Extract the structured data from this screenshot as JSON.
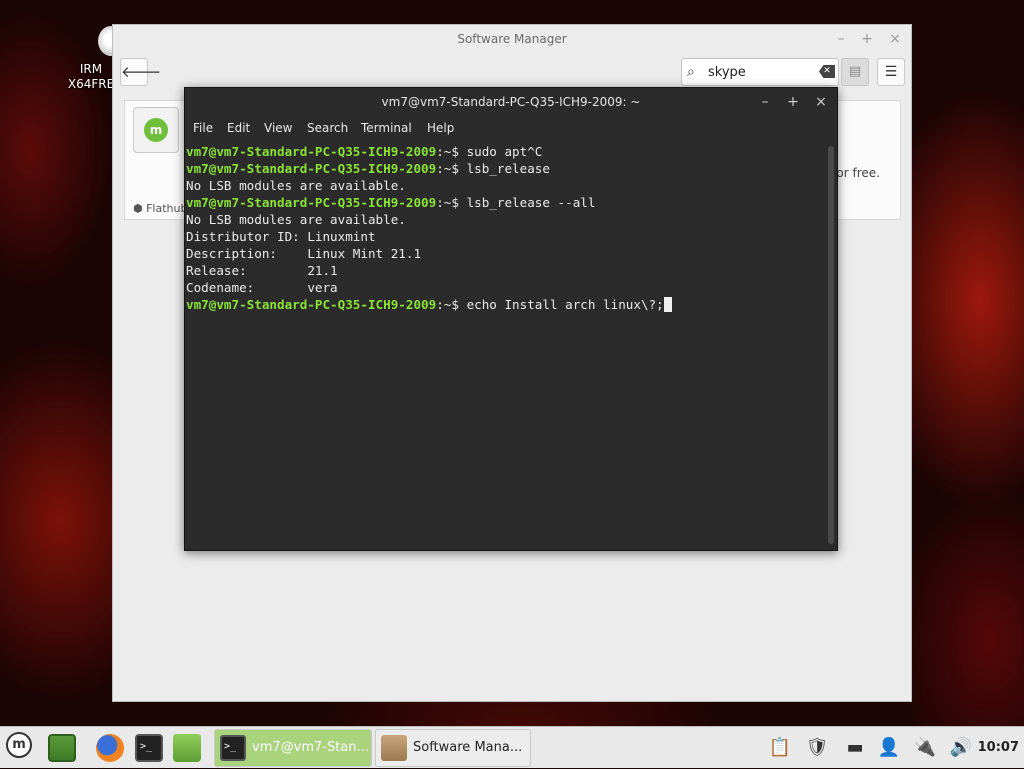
{
  "desktop": {
    "icon_label_line1": "IRM",
    "icon_label_line2": "X64FRE"
  },
  "software_manager": {
    "title": "Software Manager",
    "search_value": "skype",
    "card_source": "Flathub",
    "card_desc_fragment": "or free."
  },
  "terminal": {
    "title": "vm7@vm7-Standard-PC-Q35-ICH9-2009: ~",
    "menu": [
      "File",
      "Edit",
      "View",
      "Search",
      "Terminal",
      "Help"
    ],
    "prompt": "vm7@vm7-Standard-PC-Q35-ICH9-2009",
    "prompt_suffix": ":~$ ",
    "lines": [
      {
        "type": "cmd",
        "text": "sudo apt^C"
      },
      {
        "type": "cmd",
        "text": "lsb_release"
      },
      {
        "type": "out",
        "text": "No LSB modules are available."
      },
      {
        "type": "cmd",
        "text": "lsb_release --all"
      },
      {
        "type": "out",
        "text": "No LSB modules are available."
      },
      {
        "type": "out",
        "text": "Distributor ID:\tLinuxmint"
      },
      {
        "type": "out",
        "text": "Description:\tLinux Mint 21.1"
      },
      {
        "type": "out",
        "text": "Release:\t21.1"
      },
      {
        "type": "out",
        "text": "Codename:\tvera"
      },
      {
        "type": "cmd",
        "text": "echo Install arch linux\\?;",
        "cursor": true
      }
    ]
  },
  "taskbar": {
    "windows": [
      {
        "label": "vm7@vm7-Stan..."
      },
      {
        "label": "Software Mana..."
      }
    ],
    "clock": "10:07"
  }
}
